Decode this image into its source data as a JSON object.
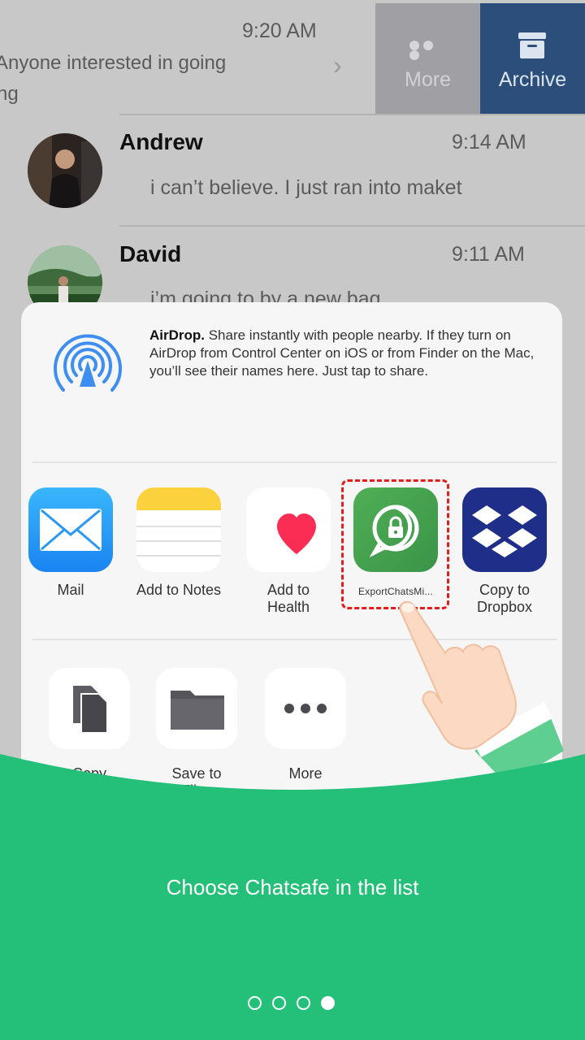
{
  "chat_list": {
    "swiped_row": {
      "time": "9:20 AM",
      "preview_line1": "Anyone interested in going",
      "preview_line2": "ng",
      "more_label": "More",
      "archive_label": "Archive"
    },
    "rows": [
      {
        "name": "Andrew",
        "time": "9:14 AM",
        "preview": "i can’t believe. I just ran into maket"
      },
      {
        "name": "David",
        "time": "9:11 AM",
        "preview": "i’m going to by a new bag"
      }
    ]
  },
  "share_sheet": {
    "airdrop_title": "AirDrop.",
    "airdrop_text": " Share instantly with people nearby. If they turn on AirDrop from Control Center on iOS or from Finder on the Mac, you’ll see their names here. Just tap to share.",
    "apps": [
      {
        "label": "Mail",
        "icon": "mail-icon"
      },
      {
        "label": "Add to Notes",
        "icon": "notes-icon"
      },
      {
        "label": "Add to Health",
        "icon": "health-icon"
      },
      {
        "label": "ExportChatsMi...",
        "icon": "export-chats-icon"
      },
      {
        "label": "Copy to Dropbox",
        "icon": "dropbox-icon"
      }
    ],
    "actions": [
      {
        "label": "Copy",
        "icon": "copy-icon"
      },
      {
        "label": "Save to Files",
        "icon": "folder-icon"
      },
      {
        "label": "More",
        "icon": "more-dots-icon"
      }
    ]
  },
  "caption": "Choose Chatsafe in the list",
  "pager": {
    "pages": 4,
    "active_page": 4
  },
  "colors": {
    "accent_green": "#24bf78",
    "archive_blue": "#2c4e7b",
    "highlight_red": "#e11d1d"
  }
}
